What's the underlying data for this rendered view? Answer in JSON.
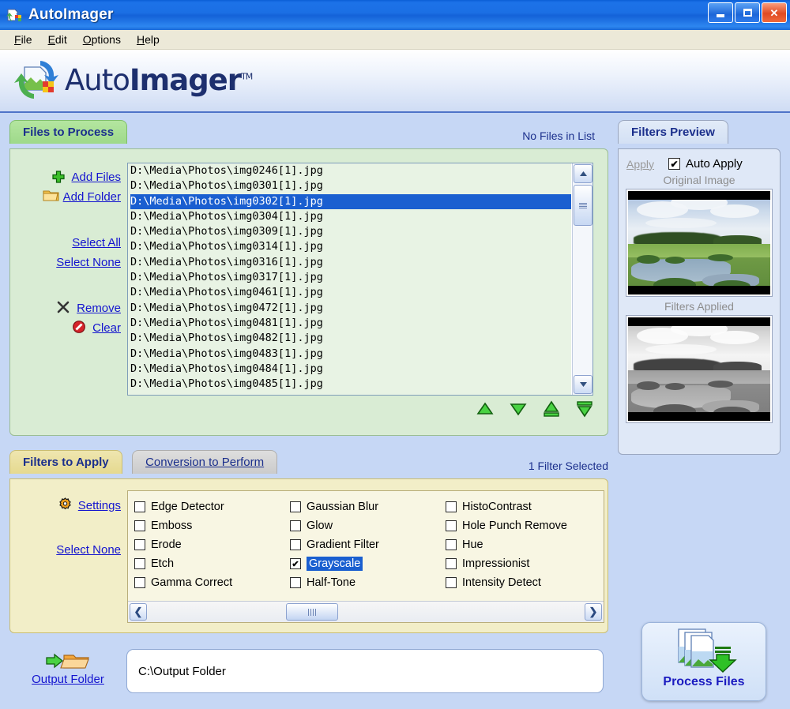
{
  "window": {
    "title": "AutoImager",
    "icon": "autoimager-icon",
    "buttons": {
      "minimize": "minimize-button",
      "maximize": "maximize-button",
      "close": "close-button"
    }
  },
  "menu": [
    {
      "label": "File",
      "accel": "F"
    },
    {
      "label": "Edit",
      "accel": "E"
    },
    {
      "label": "Options",
      "accel": "O"
    },
    {
      "label": "Help",
      "accel": "H"
    }
  ],
  "branding": {
    "name_thin": "Auto",
    "name_bold": "Imager",
    "trademark": "TM"
  },
  "files_panel": {
    "tab_label": "Files to Process",
    "status": "No Files in List",
    "actions": [
      {
        "label": "Add Files",
        "icon": "plus-icon"
      },
      {
        "label": "Add Folder",
        "icon": "folder-icon"
      },
      {
        "label": "Select All",
        "icon": ""
      },
      {
        "label": "Select None",
        "icon": ""
      },
      {
        "label": "Remove",
        "icon": "x-icon"
      },
      {
        "label": "Clear",
        "icon": "prohibition-icon"
      }
    ],
    "files": [
      {
        "path": "D:\\Media\\Photos\\img0246[1].jpg",
        "selected": false
      },
      {
        "path": "D:\\Media\\Photos\\img0301[1].jpg",
        "selected": false
      },
      {
        "path": "D:\\Media\\Photos\\img0302[1].jpg",
        "selected": true
      },
      {
        "path": "D:\\Media\\Photos\\img0304[1].jpg",
        "selected": false
      },
      {
        "path": "D:\\Media\\Photos\\img0309[1].jpg",
        "selected": false
      },
      {
        "path": "D:\\Media\\Photos\\img0314[1].jpg",
        "selected": false
      },
      {
        "path": "D:\\Media\\Photos\\img0316[1].jpg",
        "selected": false
      },
      {
        "path": "D:\\Media\\Photos\\img0317[1].jpg",
        "selected": false
      },
      {
        "path": "D:\\Media\\Photos\\img0461[1].jpg",
        "selected": false
      },
      {
        "path": "D:\\Media\\Photos\\img0472[1].jpg",
        "selected": false
      },
      {
        "path": "D:\\Media\\Photos\\img0481[1].jpg",
        "selected": false
      },
      {
        "path": "D:\\Media\\Photos\\img0482[1].jpg",
        "selected": false
      },
      {
        "path": "D:\\Media\\Photos\\img0483[1].jpg",
        "selected": false
      },
      {
        "path": "D:\\Media\\Photos\\img0484[1].jpg",
        "selected": false
      },
      {
        "path": "D:\\Media\\Photos\\img0485[1].jpg",
        "selected": false
      }
    ],
    "order_buttons": [
      {
        "name": "move-up-button",
        "icon": "triangle-up-icon"
      },
      {
        "name": "move-down-button",
        "icon": "triangle-down-icon"
      },
      {
        "name": "move-to-top-button",
        "icon": "triangle-up-bar-icon"
      },
      {
        "name": "move-to-bottom-button",
        "icon": "triangle-down-bar-icon"
      }
    ]
  },
  "preview_panel": {
    "tab_label": "Filters Preview",
    "apply_label": "Apply",
    "apply_enabled": false,
    "auto_apply_label": "Auto Apply",
    "auto_apply_checked": true,
    "original_caption": "Original Image",
    "filtered_caption": "Filters Applied"
  },
  "filters_panel": {
    "tab_active": "Filters to Apply",
    "tab_inactive": "Conversion to Perform",
    "status": "1 Filter Selected",
    "settings_label": "Settings",
    "settings_icon": "gear-icon",
    "select_none_label": "Select None",
    "columns": [
      [
        {
          "label": "Edge Detector",
          "checked": false
        },
        {
          "label": "Emboss",
          "checked": false
        },
        {
          "label": "Erode",
          "checked": false
        },
        {
          "label": "Etch",
          "checked": false
        },
        {
          "label": "Gamma Correct",
          "checked": false
        }
      ],
      [
        {
          "label": "Gaussian Blur",
          "checked": false
        },
        {
          "label": "Glow",
          "checked": false
        },
        {
          "label": "Gradient Filter",
          "checked": false
        },
        {
          "label": "Grayscale",
          "checked": true
        },
        {
          "label": "Half-Tone",
          "checked": false
        }
      ],
      [
        {
          "label": "HistoContrast",
          "checked": false
        },
        {
          "label": "Hole Punch Remove",
          "checked": false
        },
        {
          "label": "Hue",
          "checked": false
        },
        {
          "label": "Impressionist",
          "checked": false
        },
        {
          "label": "Intensity Detect",
          "checked": false
        }
      ]
    ],
    "scroll_left_icon": "chevron-left-icon",
    "scroll_right_icon": "chevron-right-icon"
  },
  "output": {
    "label": "Output Folder",
    "icon": "folder-arrow-icon",
    "path": "C:\\Output Folder"
  },
  "process": {
    "label": "Process Files",
    "icon": "process-files-icon"
  },
  "colors": {
    "titlebar_blue": "#1b6fe4",
    "files_green": "#d9ecd4",
    "filters_yellow": "#f2eec8",
    "preview_blue": "#dfe8f7",
    "selection_blue": "#1a5fd0",
    "link_blue": "#1414cf"
  }
}
